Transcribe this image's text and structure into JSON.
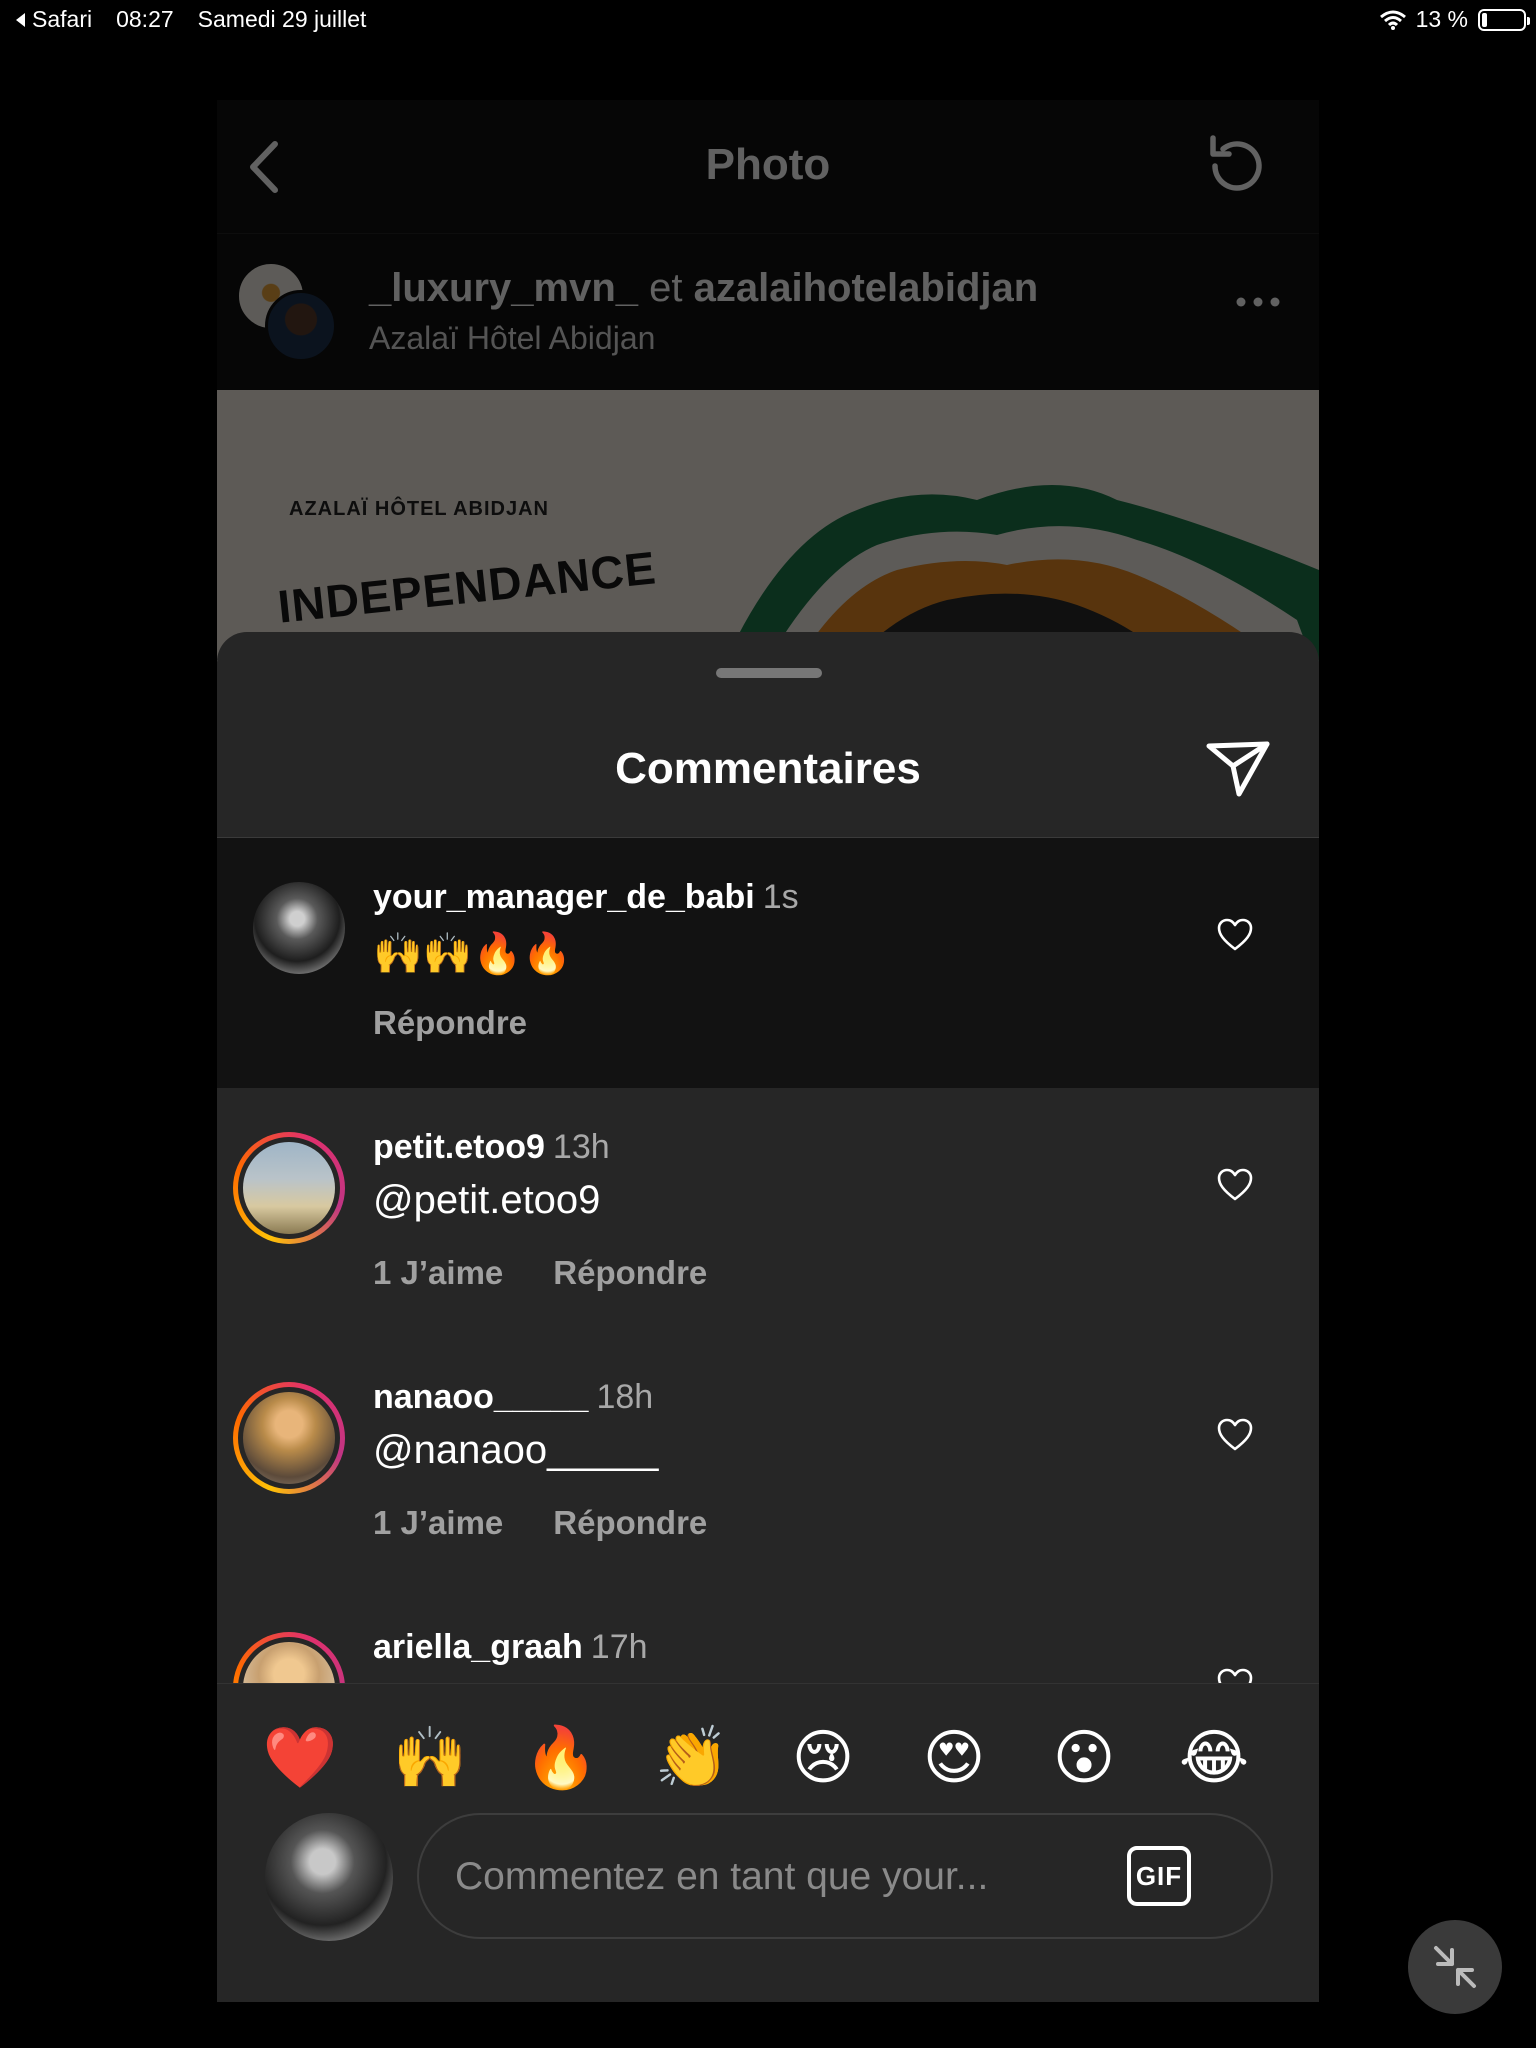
{
  "status_bar": {
    "app": "Safari",
    "time": "08:27",
    "date": "Samedi 29 juillet",
    "battery": "13 %",
    "battery_level": 0.13
  },
  "topbar": {
    "title": "Photo"
  },
  "post": {
    "user1": "_luxury_mvn_",
    "conjunction": "et",
    "user2": "azalaihotelabidjan",
    "location": "Azalaï Hôtel Abidjan",
    "image_brand": "AZALAÏ HÔTEL ABIDJAN",
    "image_headline": "INDEPENDANCE"
  },
  "sheet": {
    "title": "Commentaires",
    "comments": [
      {
        "user": "your_manager_de_babi",
        "time": "1s",
        "text": "🙌🙌🔥🔥",
        "likes": "",
        "reply": "Répondre"
      },
      {
        "user": "petit.etoo9",
        "time": "13h",
        "text": "@petit.etoo9",
        "likes": "1 J’aime",
        "reply": "Répondre"
      },
      {
        "user": "nanaoo_____",
        "time": "18h",
        "text": "@nanaoo_____",
        "likes": "1 J’aime",
        "reply": "Répondre"
      },
      {
        "user": "ariella_graah",
        "time": "17h",
        "text": "",
        "likes": "",
        "reply": ""
      }
    ],
    "emojis": [
      "❤️",
      "🙌",
      "🔥",
      "👏",
      "😢",
      "😍",
      "😮",
      "😂"
    ],
    "input_placeholder": "Commentez en tant que your...",
    "gif_label": "GIF"
  },
  "colors": {
    "background": "#000000",
    "sheet": "#262626",
    "highlight_row": "#121212",
    "secondary_text": "#a8a8a8",
    "story_ring": "#e1306c"
  }
}
